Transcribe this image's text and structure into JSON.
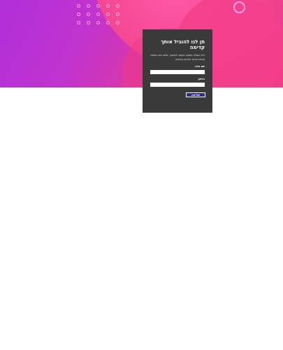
{
  "form": {
    "title": "תן לנו להוביל אותך קדימה",
    "description": "לכל שאלה והצעה בקשר לשיתוף, מלאו את הטופס ואנחנו נחזור אליכם בהקדם",
    "name_label": "שם מלא",
    "phone_label": "טלפון",
    "name_value": "",
    "phone_value": "",
    "submit_label": "שליחה"
  },
  "colors": {
    "hero_start": "#b12fd8",
    "hero_end": "#ef3c86",
    "card_background": "#3a3a3a",
    "button_background": "#2c2c8a"
  }
}
